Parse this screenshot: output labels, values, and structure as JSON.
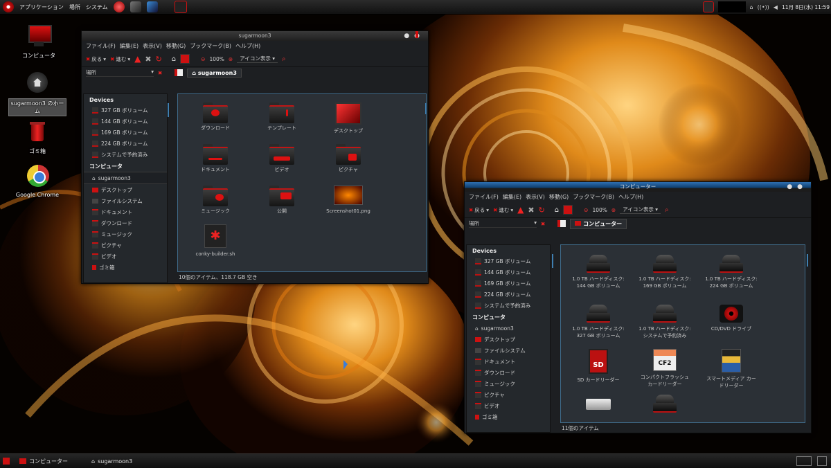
{
  "top_panel": {
    "menu": [
      "アプリケーション",
      "場所",
      "システム"
    ],
    "clock": "11月 8日(水) 11:59"
  },
  "desktop": {
    "icons": [
      {
        "label": "コンピュータ"
      },
      {
        "label": "sugarmoon3 のホーム"
      },
      {
        "label": "ゴミ箱"
      },
      {
        "label": "Google Chrome"
      }
    ]
  },
  "window1": {
    "title": "sugarmoon3",
    "menu": [
      "ファイル(F)",
      "編集(E)",
      "表示(V)",
      "移動(G)",
      "ブックマーク(B)",
      "ヘルプ(H)"
    ],
    "toolbar": {
      "back": "戻る",
      "forward": "進む",
      "zoom": "100%",
      "view": "アイコン表示"
    },
    "location": {
      "label": "場所",
      "crumb": "sugarmoon3"
    },
    "sidebar": {
      "devices_header": "Devices",
      "devices": [
        "327 GB ボリューム",
        "144 GB ボリューム",
        "169 GB ボリューム",
        "224 GB ボリューム",
        "システムで予約済み"
      ],
      "computer_header": "コンピュータ",
      "places": [
        "sugarmoon3",
        "デスクトップ",
        "ファイルシステム",
        "ドキュメント",
        "ダウンロード",
        "ミュージック",
        "ピクチャ",
        "ビデオ",
        "ゴミ箱"
      ]
    },
    "files": [
      "ダウンロード",
      "テンプレート",
      "デスクトップ",
      "ドキュメント",
      "ビデオ",
      "ピクチャ",
      "ミュージック",
      "公開",
      "Screenshot01.png",
      "conky-builder.sh"
    ],
    "status": "10個のアイテム、118.7 GB 空き"
  },
  "window2": {
    "title": "コンピューター",
    "menu": [
      "ファイル(F)",
      "編集(E)",
      "表示(V)",
      "移動(G)",
      "ブックマーク(B)",
      "ヘルプ(H)"
    ],
    "toolbar": {
      "back": "戻る",
      "forward": "進む",
      "zoom": "100%",
      "view": "アイコン表示"
    },
    "location": {
      "label": "場所",
      "crumb": "コンピューター"
    },
    "sidebar": {
      "devices_header": "Devices",
      "devices": [
        "327 GB ボリューム",
        "144 GB ボリューム",
        "169 GB ボリューム",
        "224 GB ボリューム",
        "システムで予約済み"
      ],
      "computer_header": "コンピュータ",
      "places": [
        "sugarmoon3",
        "デスクトップ",
        "ファイルシステム",
        "ドキュメント",
        "ダウンロード",
        "ミュージック",
        "ピクチャ",
        "ビデオ",
        "ゴミ箱"
      ]
    },
    "items": [
      {
        "l1": "1.0 TB ハードディスク:",
        "l2": "144 GB ボリューム"
      },
      {
        "l1": "1.0 TB ハードディスク:",
        "l2": "169 GB ボリューム"
      },
      {
        "l1": "1.0 TB ハードディスク:",
        "l2": "224 GB ボリューム"
      },
      {
        "l1": "1.0 TB ハードディスク:",
        "l2": "327 GB ボリューム"
      },
      {
        "l1": "1.0 TB ハードディスク:",
        "l2": "システムで予約済み"
      },
      {
        "l1": "CD/DVD ドライブ",
        "l2": ""
      },
      {
        "l1": "SD カードリーダー",
        "l2": ""
      },
      {
        "l1": "コンパクトフラッシュ",
        "l2": "カードリーダー"
      },
      {
        "l1": "スマートメディア カー",
        "l2": "ドリーダー"
      }
    ],
    "status": "11個のアイテム"
  },
  "bottom_panel": {
    "tasks": [
      "コンピューター",
      "sugarmoon3"
    ]
  },
  "colors": {
    "accent": "#d11414",
    "selection_blue": "#3f6b8a"
  }
}
